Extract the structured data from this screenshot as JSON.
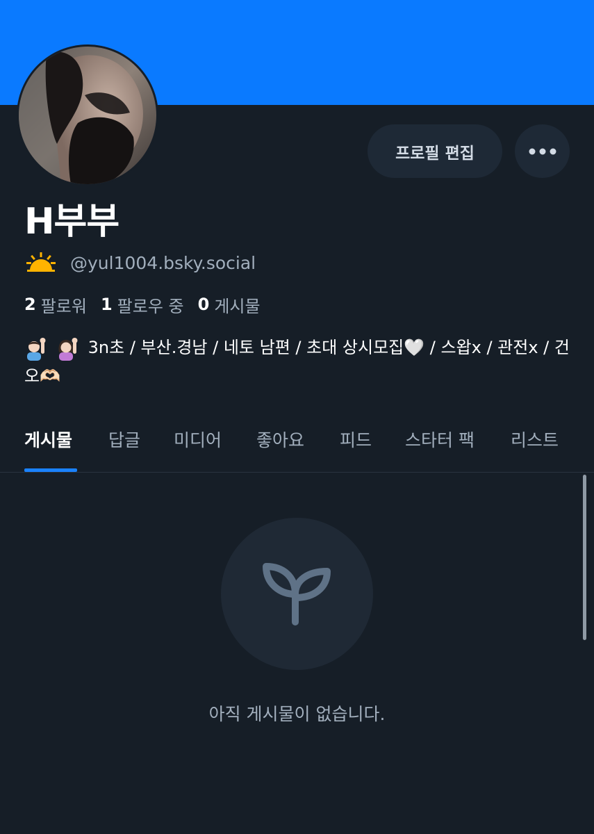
{
  "profile": {
    "display_name": "H부부",
    "handle": "@yul1004.bsky.social",
    "handle_emoji_icon": "sunrise-icon",
    "edit_button_label": "프로필 편집",
    "more_button_icon": "more-options-icon",
    "bio": "3n초 / 부산.경남 / 네토 남편 / 초대 상시모집🤍 / 스왑x / 관전x / 건오🫶🏻",
    "bio_leading_icons": [
      "man-raising-hand-icon",
      "woman-raising-hand-icon"
    ]
  },
  "stats": {
    "followers_count": "2",
    "followers_label": "팔로워",
    "following_count": "1",
    "following_label": "팔로우 중",
    "posts_count": "0",
    "posts_label": "게시물"
  },
  "tabs": [
    {
      "label": "게시물",
      "active": true
    },
    {
      "label": "답글",
      "active": false
    },
    {
      "label": "미디어",
      "active": false
    },
    {
      "label": "좋아요",
      "active": false
    },
    {
      "label": "피드",
      "active": false
    },
    {
      "label": "스타터 팩",
      "active": false
    },
    {
      "label": "리스트",
      "active": false
    }
  ],
  "empty_state": {
    "icon": "sprout-icon",
    "message": "아직 게시물이 없습니다."
  },
  "colors": {
    "banner": "#0a7aff",
    "background": "#161e27",
    "accent": "#1a82ff",
    "muted_text": "#a2afbd",
    "button_bg": "#1e2936"
  }
}
